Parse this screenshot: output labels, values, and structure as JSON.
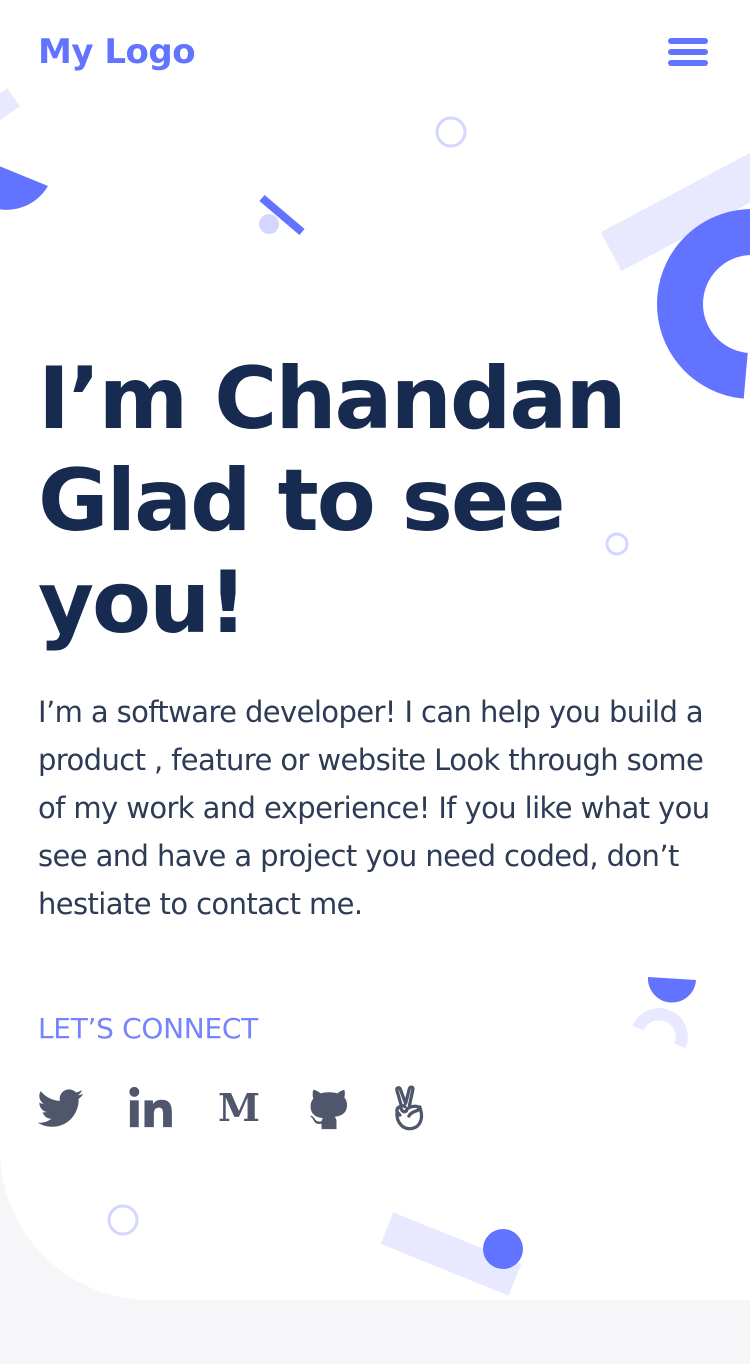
{
  "header": {
    "logo_text": "My Logo",
    "menu_icon": "hamburger-menu-icon"
  },
  "hero": {
    "headline_lines": [
      "I’m Chandan",
      "Glad to see",
      "you!"
    ],
    "intro": "I’m a software developer! I can help you build a product , feature or website Look through some of my work and experience! If you like what you see and have a project you need coded, don’t hestiate to contact me.",
    "connect_label": "LET’S CONNECT"
  },
  "socials": [
    {
      "name": "twitter",
      "icon": "twitter-icon"
    },
    {
      "name": "linkedin",
      "icon": "linkedin-icon"
    },
    {
      "name": "medium",
      "icon": "medium-icon",
      "glyph": "M"
    },
    {
      "name": "github",
      "icon": "github-icon"
    },
    {
      "name": "angellist",
      "icon": "angellist-icon"
    }
  ],
  "colors": {
    "accent": "#6273ff",
    "accent_light": "#e8e9ff",
    "heading": "#172a4f",
    "body_text": "#2e3b55",
    "icon": "#50566b",
    "page_background": "#f6f6f8"
  }
}
